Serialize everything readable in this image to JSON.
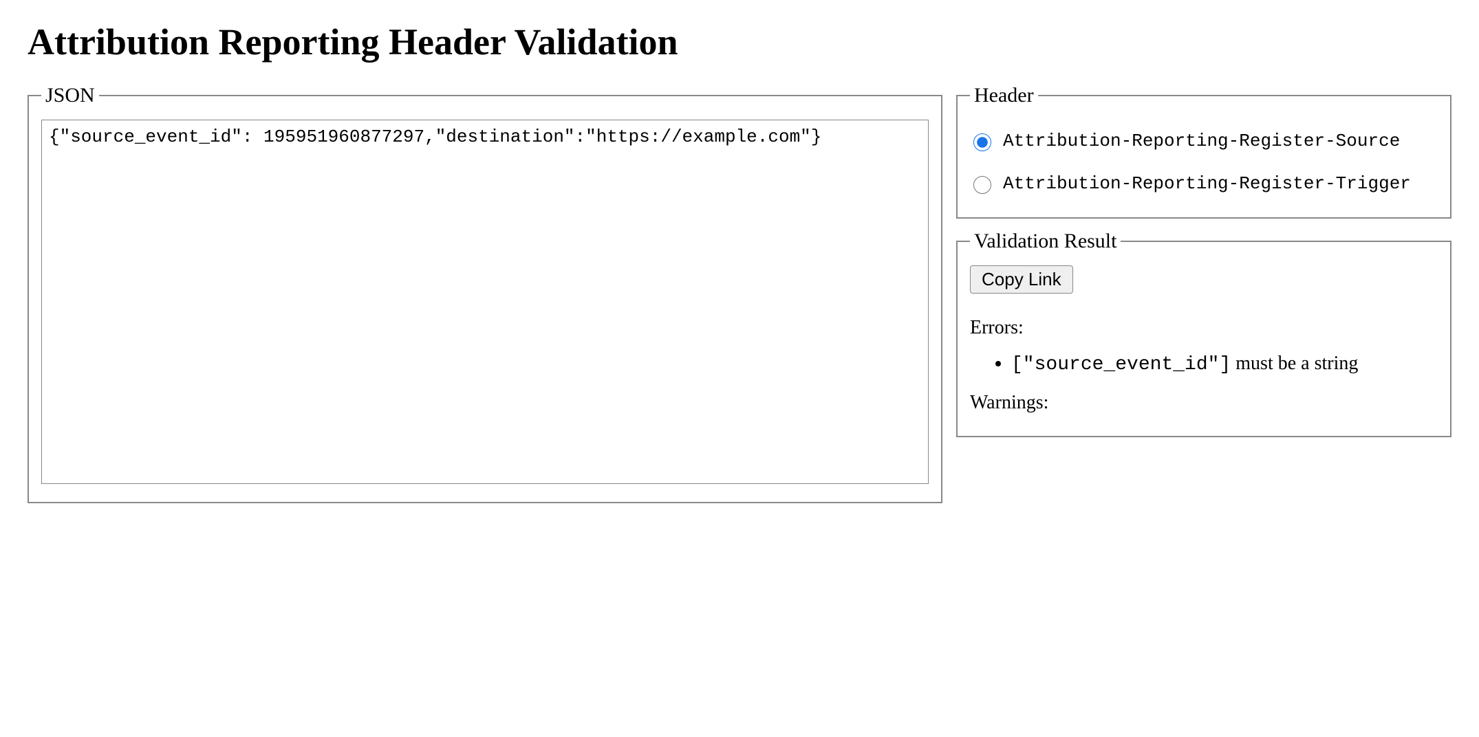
{
  "page_title": "Attribution Reporting Header Validation",
  "json_section": {
    "legend": "JSON",
    "value": "{\"source_event_id\": 195951960877297,\"destination\":\"https://example.com\"}"
  },
  "header_section": {
    "legend": "Header",
    "options": [
      {
        "label": "Attribution-Reporting-Register-Source",
        "checked": true
      },
      {
        "label": "Attribution-Reporting-Register-Trigger",
        "checked": false
      }
    ]
  },
  "result_section": {
    "legend": "Validation Result",
    "copy_button": "Copy Link",
    "errors_label": "Errors:",
    "errors": [
      {
        "path": "[\"source_event_id\"]",
        "message": "must be a string"
      }
    ],
    "warnings_label": "Warnings:",
    "warnings": []
  }
}
